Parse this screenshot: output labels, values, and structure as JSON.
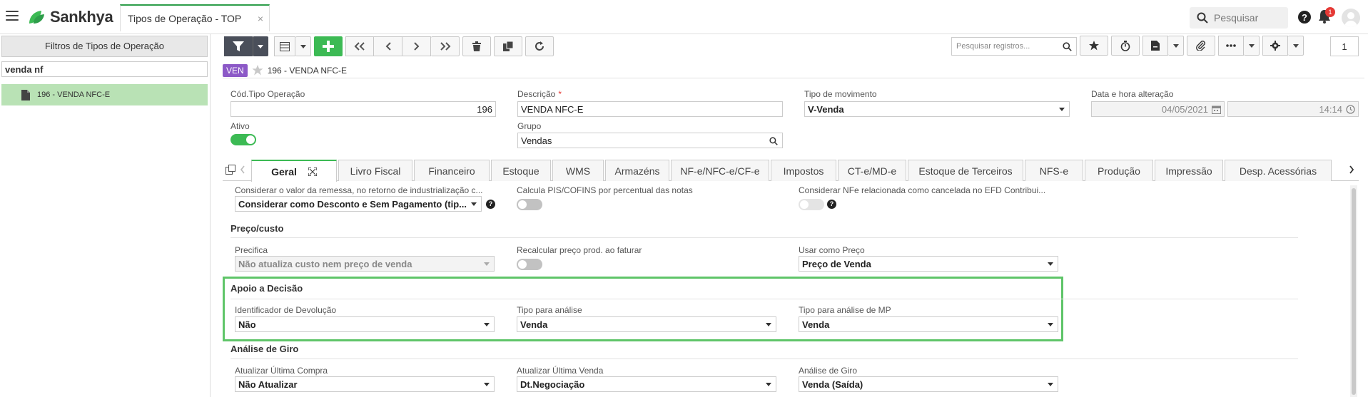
{
  "header": {
    "brand": "Sankhya",
    "tab_title": "Tipos de Operação - TOP",
    "tab_close": "×",
    "search_placeholder": "Pesquisar",
    "notification_count": "1",
    "accent_color": "#3cba54"
  },
  "left_panel": {
    "title": "Filtros de Tipos de Operação",
    "filter_value": "venda nf",
    "items": [
      {
        "label": "196 - VENDA NFC-E"
      }
    ]
  },
  "toolbar": {
    "search_placeholder": "Pesquisar registros...",
    "page": "1"
  },
  "record": {
    "badge": "VEN",
    "title": "196 - VENDA NFC-E"
  },
  "form": {
    "cod_label": "Cód.Tipo Operação",
    "cod_value": "196",
    "desc_label": "Descrição",
    "desc_required": "*",
    "desc_value": "VENDA NFC-E",
    "tipo_mov_label": "Tipo de movimento",
    "tipo_mov_value": "V-Venda",
    "data_label": "Data e hora alteração",
    "data_value": "04/05/2021",
    "hora_value": "14:14",
    "ativo_label": "Ativo",
    "ativo_on": true,
    "grupo_label": "Grupo",
    "grupo_value": "Vendas"
  },
  "tabs": [
    {
      "label": "Geral",
      "active": true
    },
    {
      "label": "Livro Fiscal"
    },
    {
      "label": "Financeiro"
    },
    {
      "label": "Estoque"
    },
    {
      "label": "WMS"
    },
    {
      "label": "Armazéns"
    },
    {
      "label": "NF-e/NFC-e/CF-e"
    },
    {
      "label": "Impostos"
    },
    {
      "label": "CT-e/MD-e"
    },
    {
      "label": "Estoque de Terceiros"
    },
    {
      "label": "NFS-e"
    },
    {
      "label": "Produção"
    },
    {
      "label": "Impressão"
    },
    {
      "label": "Desp. Acessórias"
    }
  ],
  "geral": {
    "remessa_label": "Considerar o valor da remessa, no retorno de industrialização c...",
    "remessa_value": "Considerar como Desconto e Sem Pagamento (tip...",
    "pis_label": "Calcula PIS/COFINS por percentual das notas",
    "nfe_label": "Considerar NFe relacionada como cancelada no EFD Contribui...",
    "preco_section": "Preço/custo",
    "precifica_label": "Precifica",
    "precifica_value": "Não atualiza custo nem preço de venda",
    "recalc_label": "Recalcular preço prod. ao faturar",
    "usar_preco_label": "Usar como Preço",
    "usar_preco_value": "Preço de Venda",
    "apoio_section": "Apoio a Decisão",
    "ident_dev_label": "Identificador de Devolução",
    "ident_dev_value": "Não",
    "tipo_analise_label": "Tipo para análise",
    "tipo_analise_value": "Venda",
    "tipo_mp_label": "Tipo para análise de MP",
    "tipo_mp_value": "Venda",
    "giro_section": "Análise de Giro",
    "ult_compra_label": "Atualizar Última Compra",
    "ult_compra_value": "Não Atualizar",
    "ult_venda_label": "Atualizar Última Venda",
    "ult_venda_value": "Dt.Negociação",
    "analise_giro_label": "Análise de Giro",
    "analise_giro_value": "Venda (Saída)"
  }
}
